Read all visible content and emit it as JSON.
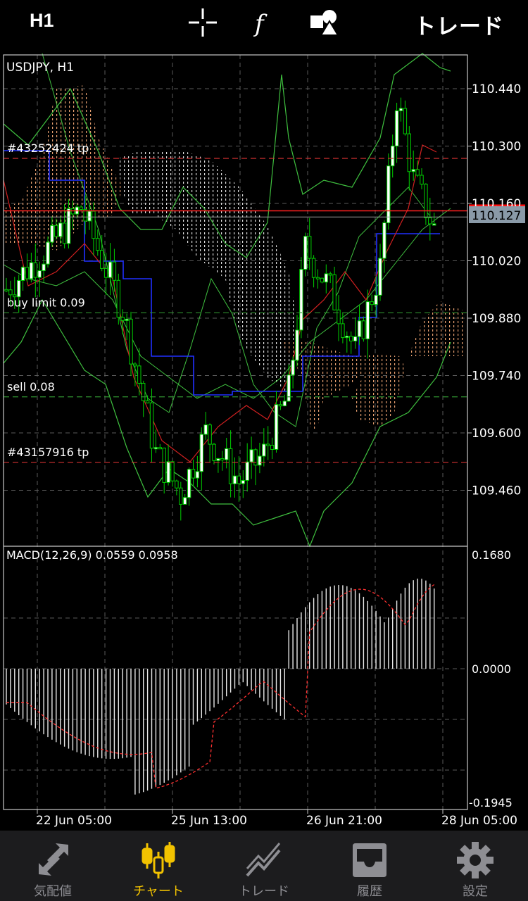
{
  "toolbar": {
    "timeframe": "H1",
    "crosshair_icon": "crosshair-icon",
    "indicator_icon": "function-icon",
    "objects_icon": "shapes-icon",
    "trade_label": "トレード"
  },
  "chart": {
    "symbol_label": "USDJPY, H1",
    "price_axis": [
      "110.440",
      "110.300",
      "110.160",
      "110.020",
      "109.880",
      "109.740",
      "109.600",
      "109.460"
    ],
    "current_price": "110.127",
    "order_lines": [
      {
        "label": "#43252424 tp",
        "price": 110.27,
        "color": "#d03030"
      },
      {
        "label": "buy limit 0.09",
        "price": 109.893,
        "color": "#2f8f2f"
      },
      {
        "label": "sell 0.08",
        "price": 109.688,
        "color": "#2f8f2f"
      },
      {
        "label": "#43157916 tp",
        "price": 109.528,
        "color": "#d03030"
      }
    ],
    "bid_line_price": 110.127,
    "ask_line_price": 110.142,
    "time_axis": [
      "22 Jun 05:00",
      "25 Jun 13:00",
      "26 Jun 21:00",
      "28 Jun 05:00"
    ],
    "colors": {
      "bull": "#ffffff",
      "wick": "#00d000",
      "cloud_a": "#e8a070",
      "cloud_b": "#dddddd",
      "tenkan": "#d02020",
      "kijun": "#2030ff",
      "bands": "#3fc03f",
      "grid": "#606060"
    }
  },
  "macd": {
    "label": "MACD(12,26,9) 0.0559 0.0958",
    "axis_top": "0.1680",
    "axis_zero": "0.0000",
    "axis_bottom": "-0.1945"
  },
  "chart_data": {
    "type": "line",
    "title": "USDJPY, H1",
    "ylim": [
      109.36,
      110.51
    ],
    "x": [
      "22 Jun 05:00",
      "25 Jun 13:00",
      "26 Jun 21:00",
      "28 Jun 05:00"
    ],
    "series": [
      {
        "name": "MACD(12,26,9)",
        "values": [
          0.0559
        ]
      }
    ]
  },
  "tabs": [
    {
      "label": "気配値",
      "icon": "quotes-arrows-icon",
      "active": false
    },
    {
      "label": "チャート",
      "icon": "candlestick-icon",
      "active": true
    },
    {
      "label": "トレード",
      "icon": "trend-icon",
      "active": false
    },
    {
      "label": "履歴",
      "icon": "inbox-icon",
      "active": false
    },
    {
      "label": "設定",
      "icon": "gear-icon",
      "active": false
    }
  ]
}
